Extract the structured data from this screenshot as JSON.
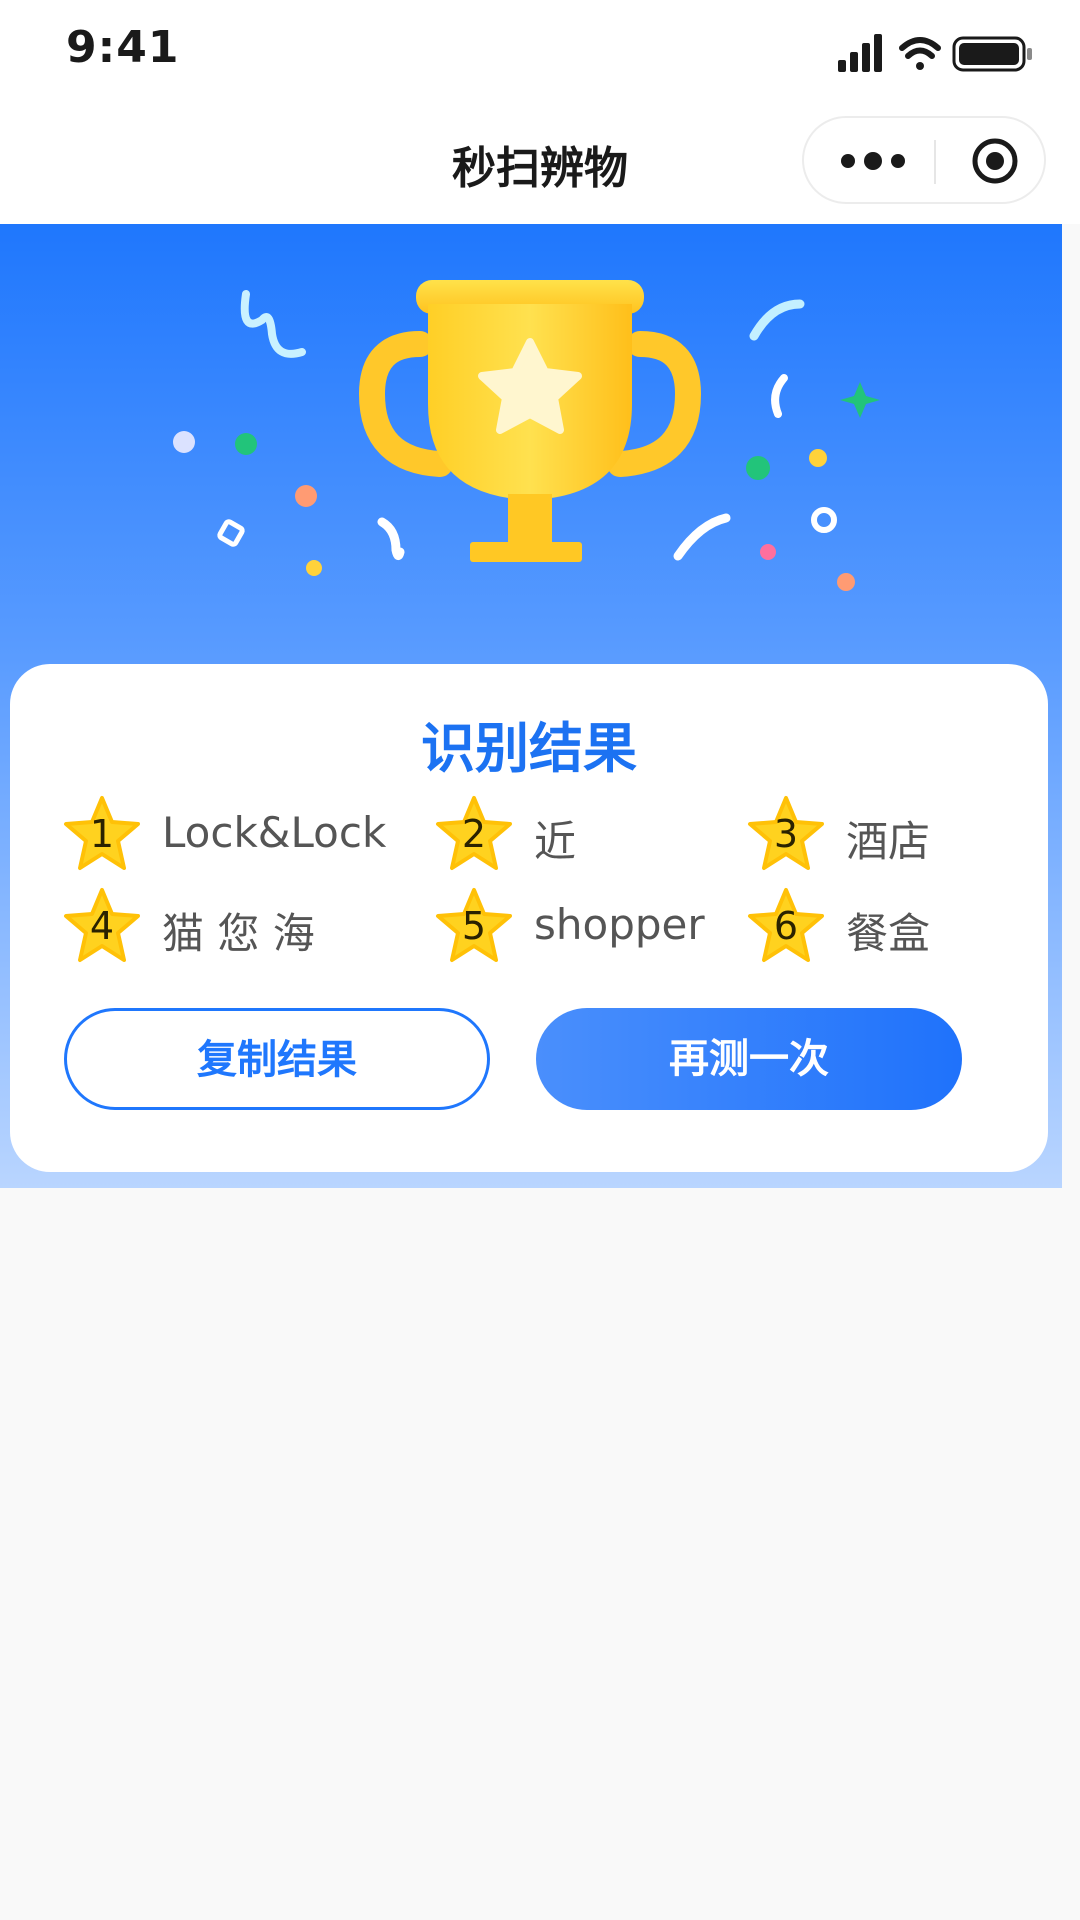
{
  "status_bar": {
    "time": "9:41"
  },
  "nav": {
    "title": "秒扫辨物"
  },
  "result_card": {
    "title": "识别结果",
    "results": [
      {
        "rank": "1",
        "label": "Lock&Lock"
      },
      {
        "rank": "2",
        "label": "近"
      },
      {
        "rank": "3",
        "label": "酒店"
      },
      {
        "rank": "4",
        "label": "猫 您 海"
      },
      {
        "rank": "5",
        "label": "shopper"
      },
      {
        "rank": "6",
        "label": "餐盒"
      }
    ],
    "copy_button": "复制结果",
    "retry_button": "再测一次"
  },
  "colors": {
    "brand_blue": "#1f77fd",
    "title_blue": "#1c72f2",
    "trophy_gold": "#ffc933",
    "star_gold": "#ffd21f"
  },
  "icons": [
    "signal-icon",
    "wifi-icon",
    "battery-icon",
    "more-icon",
    "target-icon",
    "trophy-icon",
    "star-icon"
  ]
}
